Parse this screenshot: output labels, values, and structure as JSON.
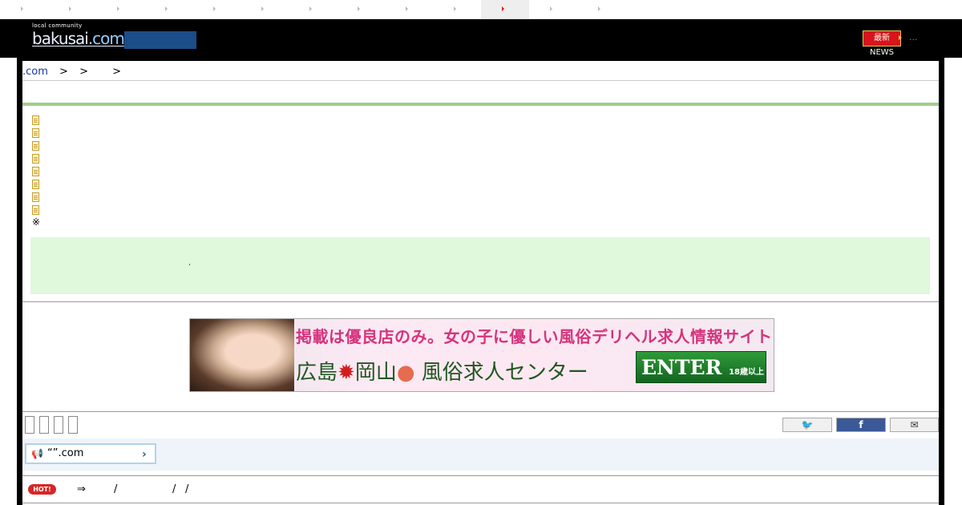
{
  "topnav": {
    "active_index": 10
  },
  "header": {
    "logo_tag": "local community",
    "logo_main": "bakusai",
    "logo_domain": ".com",
    "news_badge": "最新NEWS",
    "more": "..."
  },
  "breadcrumb": {
    "home": ".com",
    "sep1": ">",
    "sep2": ">",
    "sep3": ">"
  },
  "notes": {
    "mark": "※"
  },
  "banner": {
    "line1": "掲載は優良店のみ。女の子に優しい風俗デリヘル求人情報サイト",
    "line2_a": "広島",
    "line2_b": "岡山",
    "line2_c": "風俗求人センター",
    "enter": "ENTER",
    "age": "18歳以上"
  },
  "notice": {
    "text": "“”.com"
  },
  "hotrow": {
    "badge": "HOT!",
    "arrow": "⇒",
    "s1": "/",
    "s2": "/",
    "s3": "/"
  },
  "colors": {
    "header_bg": "#000000",
    "green_rule": "#9ecf8a",
    "green_box": "#e0f8dc",
    "facebook": "#3b5998"
  }
}
